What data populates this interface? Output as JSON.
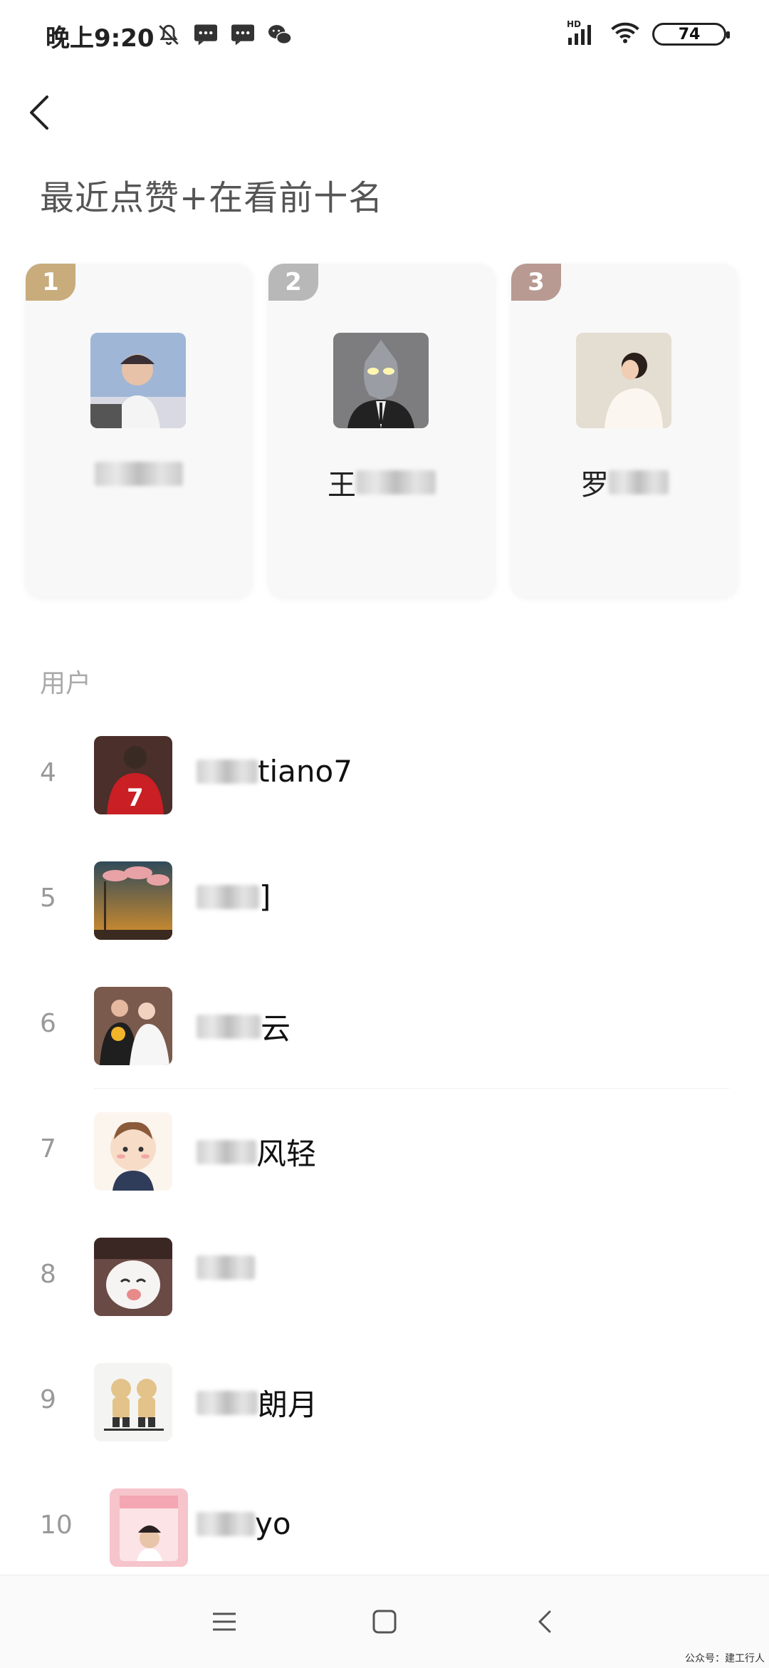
{
  "status_bar": {
    "time": "晚上9:20",
    "battery": "74",
    "network_label": "HD",
    "icons_left": [
      "bell-off-icon",
      "message-icon",
      "message-icon",
      "wechat-icon"
    ],
    "icons_right": [
      "signal-icon",
      "wifi-icon",
      "battery-icon"
    ]
  },
  "header": {
    "back_icon": "chevron-left-icon",
    "title": "最近点赞+在看前十名"
  },
  "top3": [
    {
      "rank": "1",
      "name_visible": "",
      "badge_color": "#c8ac7c"
    },
    {
      "rank": "2",
      "name_visible": "王",
      "badge_color": "#b8b8b8"
    },
    {
      "rank": "3",
      "name_visible": "罗",
      "badge_color": "#b89a92"
    }
  ],
  "section": {
    "label": "用户"
  },
  "users": [
    {
      "rank": "4",
      "name_visible": "tiano7"
    },
    {
      "rank": "5",
      "name_visible": "]"
    },
    {
      "rank": "6",
      "name_visible": "云"
    },
    {
      "rank": "7",
      "name_visible": "风轻"
    },
    {
      "rank": "8",
      "name_visible": ""
    },
    {
      "rank": "9",
      "name_visible": "朗月"
    },
    {
      "rank": "10",
      "name_visible": "yo"
    }
  ],
  "navbar": {
    "icons": [
      "menu-icon",
      "home-square-icon",
      "back-triangle-icon"
    ]
  },
  "watermark": "公众号：建工行人"
}
